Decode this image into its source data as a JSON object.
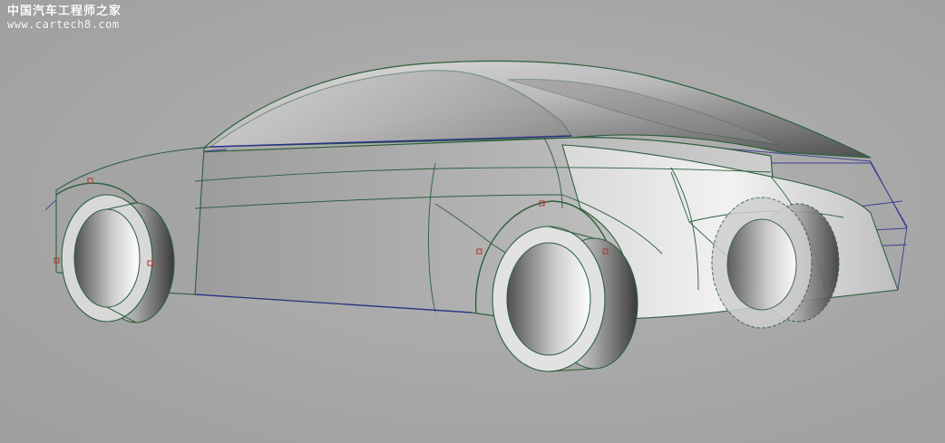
{
  "watermark": {
    "site_name": "中国汽车工程师之家",
    "site_url": "www.cartech8.com"
  },
  "colors": {
    "background": "#a9a9a9",
    "surface_edge": "#2d5f3c",
    "construction_curve": "#2a2f8c",
    "control_point": "#b0302c"
  },
  "scene": {
    "object": "car-surface-model"
  }
}
